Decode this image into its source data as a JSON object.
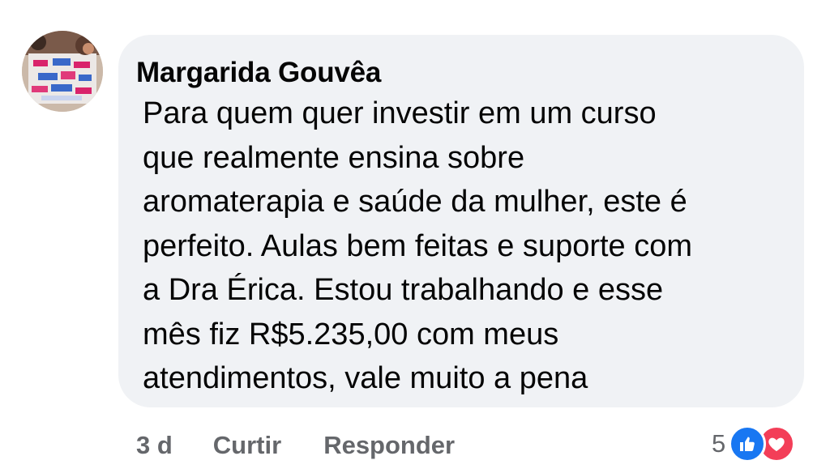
{
  "comment": {
    "author": "Margarida Gouvêa",
    "text": "Para quem quer investir em um curso\nque realmente ensina sobre\naromaterapia e saúde da mulher, este é\nperfeito. Aulas bem feitas e suporte com\na Dra Érica. Estou trabalhando e esse\nmês fiz R$5.235,00 com meus\natendimentos, vale muito a pena"
  },
  "actions": {
    "time": "3 d",
    "like_label": "Curtir",
    "reply_label": "Responder"
  },
  "reactions": {
    "count": "5",
    "icons": [
      "like-icon",
      "love-icon"
    ],
    "like_color": "#1877f2",
    "love_color": "#f33e58"
  },
  "colors": {
    "bubble": "#f0f2f5",
    "text": "#050505",
    "secondary": "#65676b"
  }
}
